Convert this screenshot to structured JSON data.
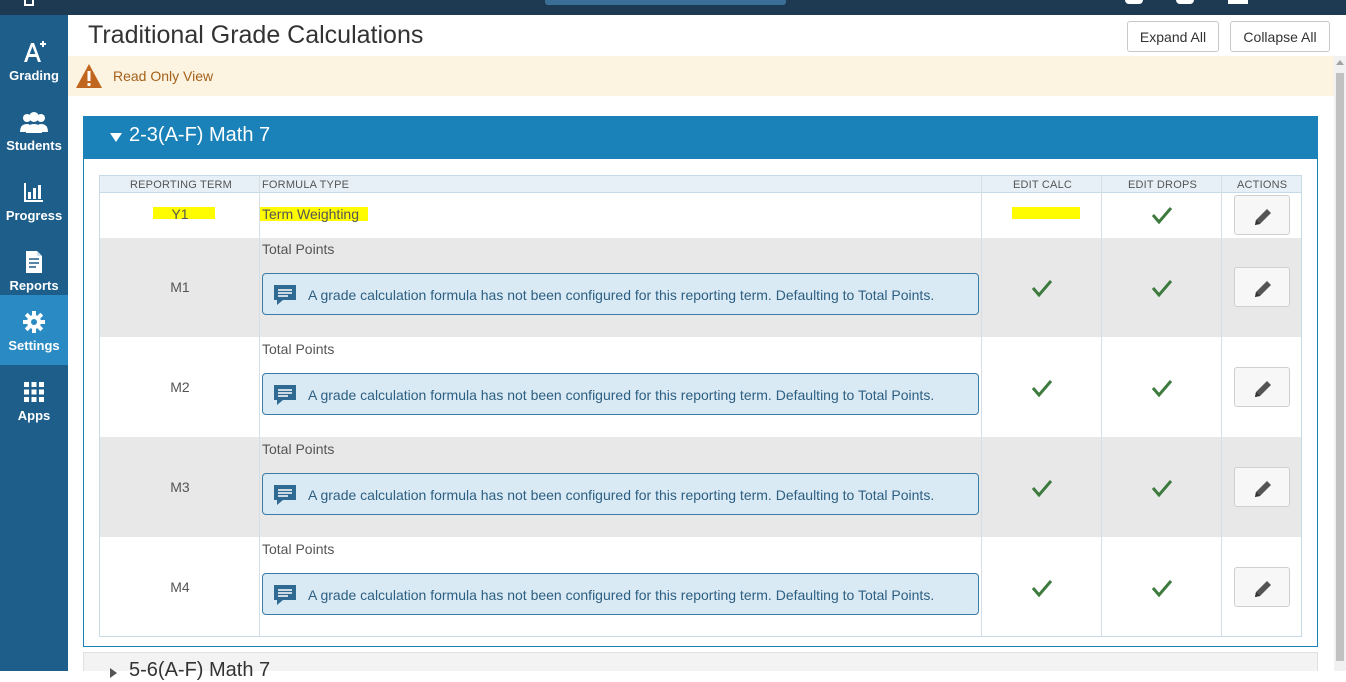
{
  "nav": {
    "items": [
      {
        "label": "Grading",
        "icon": "grading-icon"
      },
      {
        "label": "Students",
        "icon": "students-icon"
      },
      {
        "label": "Progress",
        "icon": "progress-icon"
      },
      {
        "label": "Reports",
        "icon": "reports-icon"
      },
      {
        "label": "Settings",
        "icon": "settings-icon"
      },
      {
        "label": "Apps",
        "icon": "apps-icon"
      }
    ],
    "active": "Settings"
  },
  "page": {
    "title": "Traditional Grade Calculations",
    "expand_all_label": "Expand All",
    "collapse_all_label": "Collapse All",
    "alert_text": "Read Only View"
  },
  "section": {
    "title": "2-3(A-F) Math 7",
    "next_title": "5-6(A-F) Math 7"
  },
  "table": {
    "headers": {
      "term": "REPORTING TERM",
      "formula": "FORMULA TYPE",
      "edit_calc": "EDIT CALC",
      "edit_drops": "EDIT DROPS",
      "actions": "ACTIONS"
    },
    "rows": [
      {
        "term": "Y1",
        "formula": "Term Weighting",
        "message": "",
        "edit_calc": false,
        "edit_drops": true
      },
      {
        "term": "M1",
        "formula": "Total Points",
        "message": "A grade calculation formula has not been configured for this reporting term. Defaulting to Total Points.",
        "edit_calc": true,
        "edit_drops": true
      },
      {
        "term": "M2",
        "formula": "Total Points",
        "message": "A grade calculation formula has not been configured for this reporting term. Defaulting to Total Points.",
        "edit_calc": true,
        "edit_drops": true
      },
      {
        "term": "M3",
        "formula": "Total Points",
        "message": "A grade calculation formula has not been configured for this reporting term. Defaulting to Total Points.",
        "edit_calc": true,
        "edit_drops": true
      },
      {
        "term": "M4",
        "formula": "Total Points",
        "message": "A grade calculation formula has not been configured for this reporting term. Defaulting to Total Points.",
        "edit_calc": true,
        "edit_drops": true
      }
    ]
  },
  "colors": {
    "sidebar": "#1d5e8a",
    "sidebar_active": "#2a8bc4",
    "panel_header": "#1a82b8",
    "check": "#3d7a3d",
    "highlight": "#fffb00",
    "alert_bg": "#fcf3e0",
    "alert_text": "#a5611b"
  }
}
